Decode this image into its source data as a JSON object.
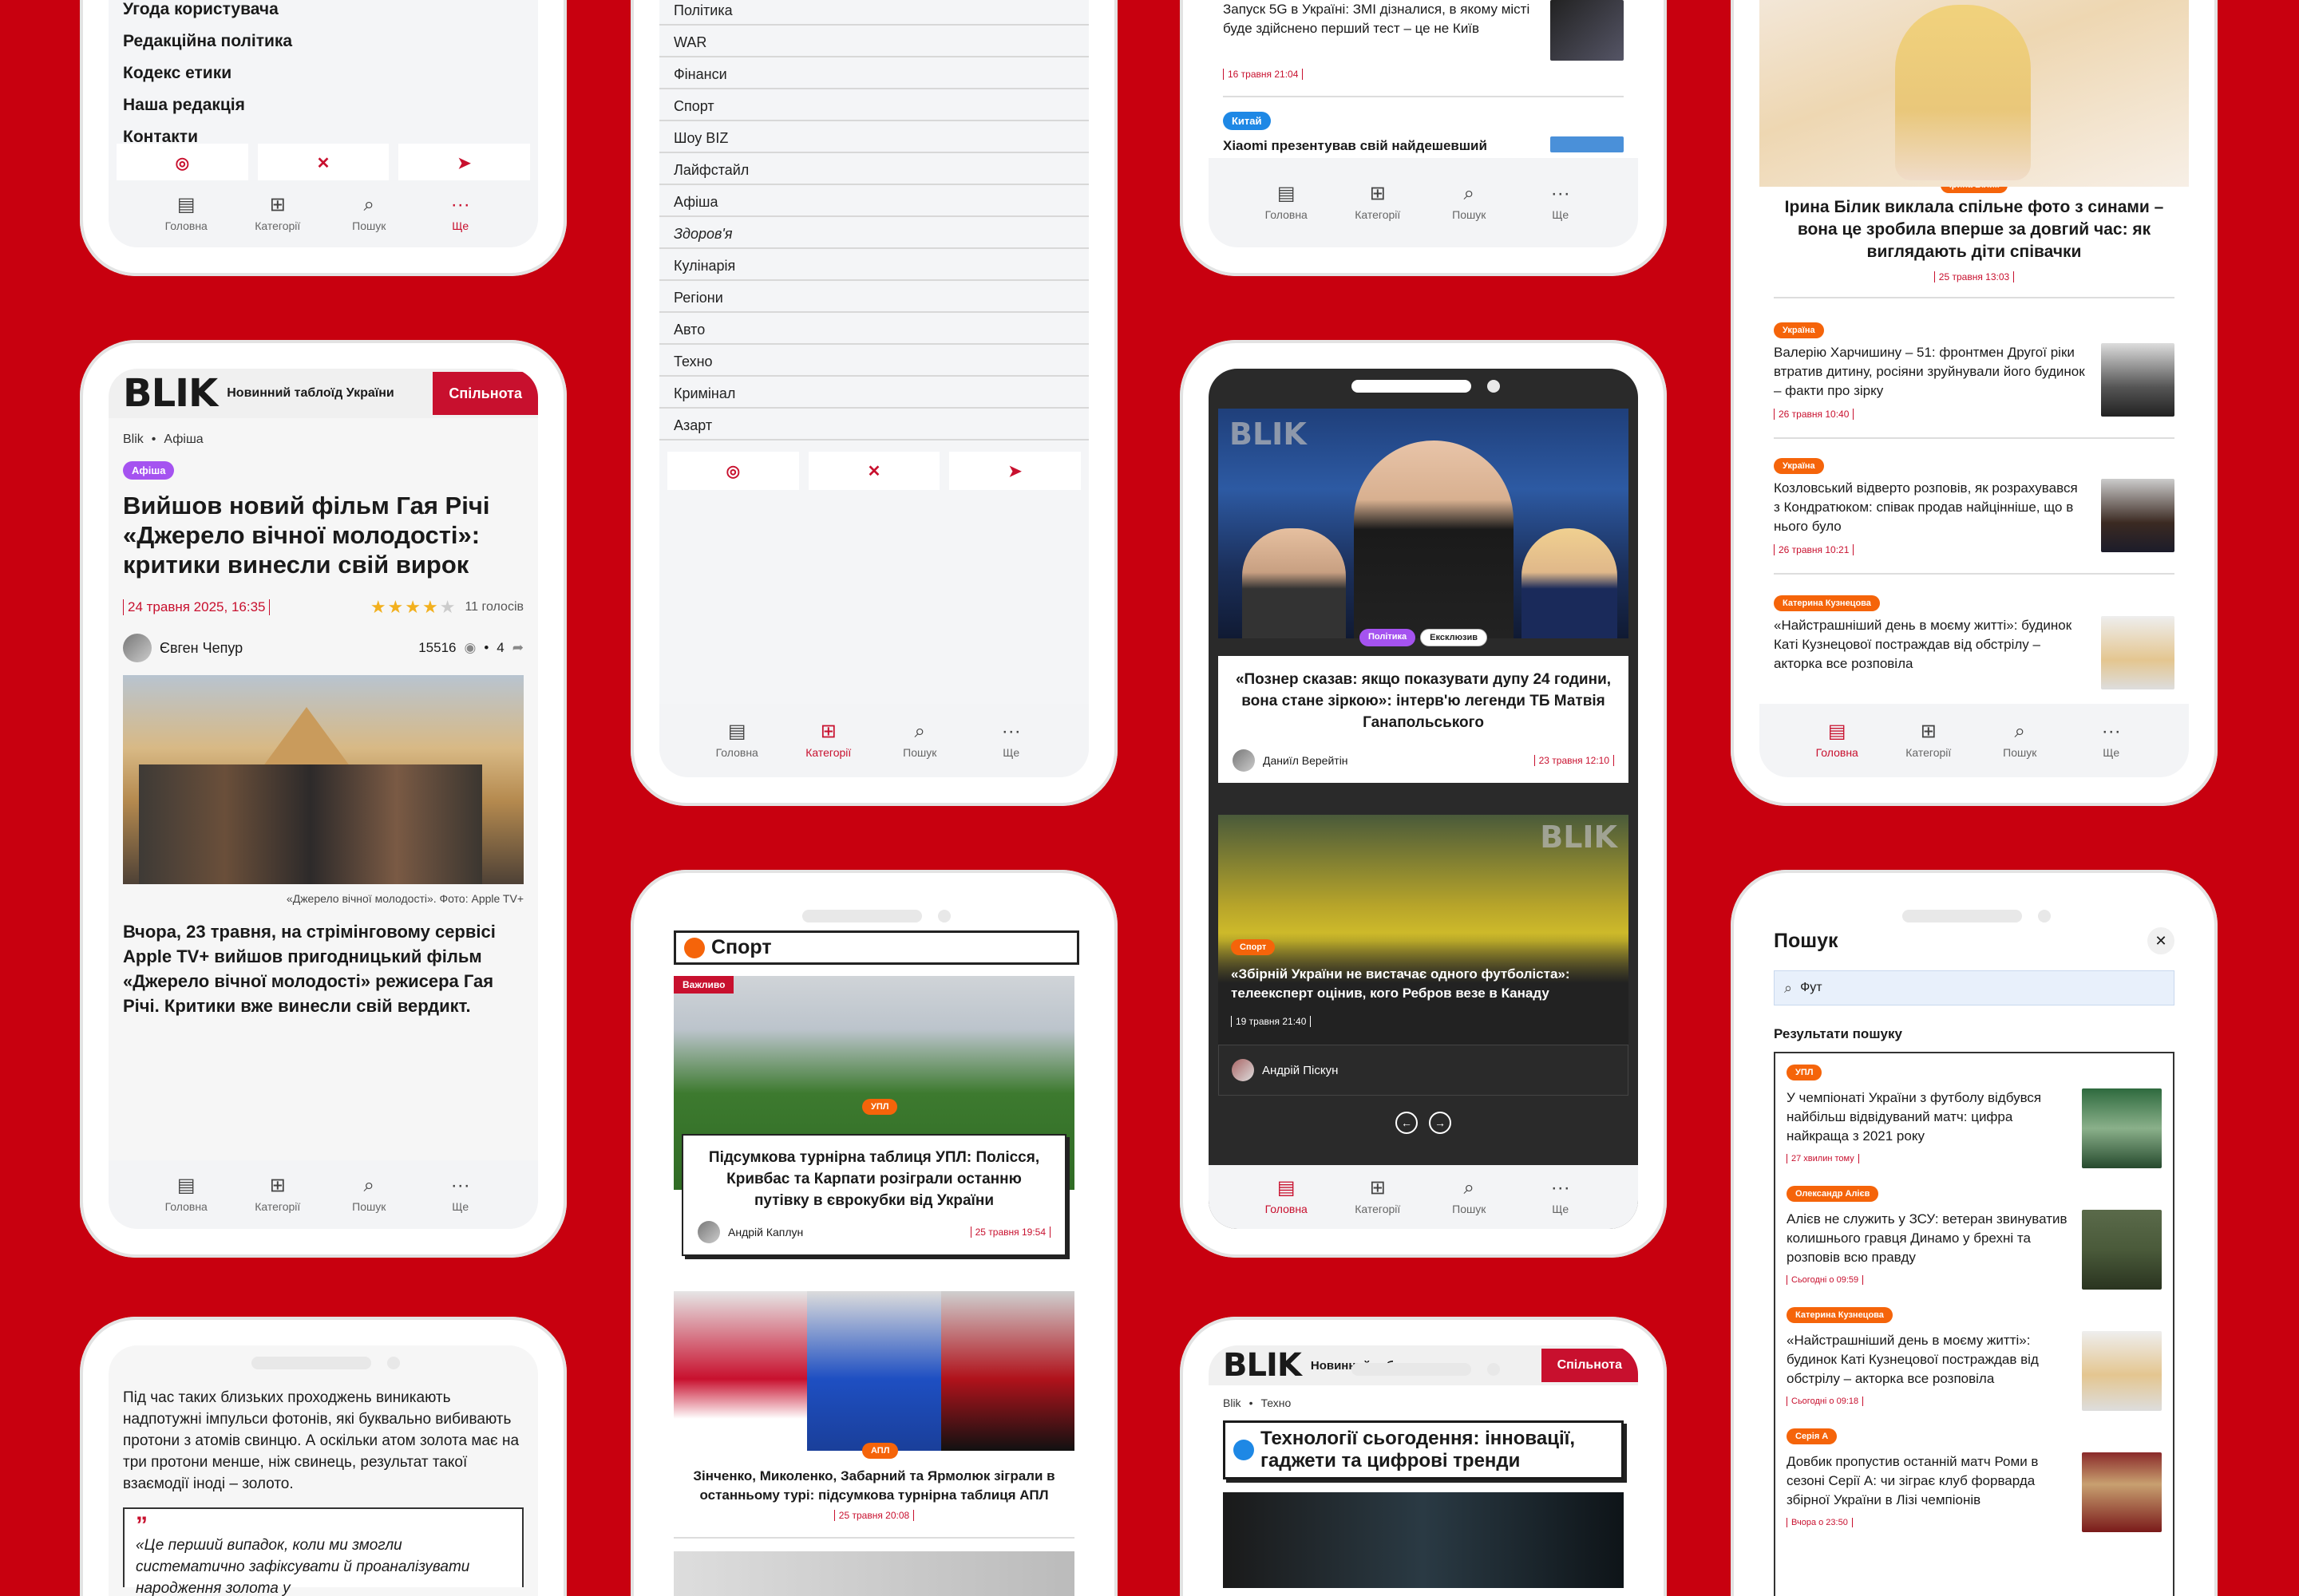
{
  "phone1": {
    "menu": [
      "Угода користувача",
      "Редакційна політика",
      "Кодекс етики",
      "Наша редакція",
      "Контакти"
    ],
    "tabs": [
      "Головна",
      "Категорії",
      "Пошук",
      "Ще"
    ]
  },
  "phone2": {
    "categories": [
      "Політика",
      "WAR",
      "Фінанси",
      "Спорт",
      "Шоу BIZ",
      "Лайфстайл",
      "Афіша",
      "Здоров'я",
      "Кулінарія",
      "Регіони",
      "Авто",
      "Техно",
      "Кримінал",
      "Азарт"
    ],
    "tabs": [
      "Головна",
      "Категорії",
      "Пошук",
      "Ще"
    ]
  },
  "phone3": {
    "news1_title": "Запуск 5G в Україні: ЗМІ дізналися, в якому місті буде здійснено перший тест – це не Київ",
    "news1_date": "16 травня 21:04",
    "badge": "Китай",
    "news2_title": "Xiaomi презентував свій найдешевший",
    "tabs": [
      "Головна",
      "Категорії",
      "Пошук",
      "Ще"
    ]
  },
  "phone4": {
    "hero_badge": "Ірина Білик",
    "hero_title": "Ірина Білик виклала спільне фото з синами – вона це зробила вперше за довгий час: як виглядають діти співачки",
    "hero_date": "25 травня 13:03",
    "items": [
      {
        "badge": "Україна",
        "title": "Валерію Харчишину – 51: фронтмен Другої ріки втратив дитину, росіяни зруйнували його будинок – факти про зірку",
        "date": "26 травня 10:40"
      },
      {
        "badge": "Україна",
        "title": "Козловський відверто розповів, як розрахувався з Кондратюком: співак продав найцінніше, що в нього було",
        "date": "26 травня 10:21"
      },
      {
        "badge": "Катерина Кузнецова",
        "title": "«Найстрашніший день в моєму житті»: будинок Каті Кузнецової постраждав від обстрілу – акторка все розповіла",
        "date": ""
      }
    ],
    "tabs": [
      "Головна",
      "Категорії",
      "Пошук",
      "Ще"
    ]
  },
  "phone5": {
    "logo": "BLIK",
    "ticker": "Новинний таблоїд України",
    "community_btn": "Спільнота",
    "crumb_home": "Blik",
    "crumb_section": "Афіша",
    "badge": "Афіша",
    "title": "Вийшов новий фільм Гая Річі «Джерело вічної молодості»: критики винесли свій вирок",
    "date": "24 травня 2025, 16:35",
    "votes": "11 голосів",
    "author": "Євген Чепур",
    "views": "15516",
    "comments": "4",
    "caption": "«Джерело вічної молодості». Фото: Apple TV+",
    "lead": "Вчора, 23 травня, на стрімінговому сервісі Apple TV+ вийшов пригодницький фільм «Джерело вічної молодості» режисера Гая Річі. Критики вже винесли свій вердикт.",
    "tabs": [
      "Головна",
      "Категорії",
      "Пошук",
      "Ще"
    ]
  },
  "phone6": {
    "section": "Спорт",
    "important": "Важливо",
    "badge1": "УПЛ",
    "card_title": "Підсумкова турнірна таблиця УПЛ: Полісся, Кривбас та Карпати розіграли останню путівку в єврокубки від України",
    "card_author": "Андрій Каплун",
    "card_date": "25 травня 19:54",
    "badge2": "АПЛ",
    "news2_title": "Зінченко, Миколенко, Забарний та Ярмолюк зіграли в останньому турі: підсумкова турнірна таблиця АПЛ",
    "news2_date": "25 травня 20:08"
  },
  "phone7": {
    "badges": [
      "Політика",
      "Ексклюзив"
    ],
    "card_title": "«Познер сказав: якщо показувати дупу 24 години, вона стане зіркою»: інтерв'ю легенди ТБ Матвія Ганапольського",
    "card_author": "Даниїл Верейтін",
    "card_date": "23 травня 12:10",
    "sport_badge": "Спорт",
    "sport_title": "«Збірній України не вистачає одного футболіста»: телеексперт оцінив, кого Ребров везе в Канаду",
    "sport_date": "19 травня 21:40",
    "sport_author": "Андрій Піскун",
    "tabs": [
      "Головна",
      "Категорії",
      "Пошук",
      "Ще"
    ]
  },
  "phone8": {
    "title": "Пошук",
    "query": "Фут",
    "results_label": "Результати пошуку",
    "results": [
      {
        "badge": "УПЛ",
        "title": "У чемпіонаті України з футболу відбувся найбільш відвідуваний матч: цифра найкраща з 2021 року",
        "date": "27 хвилин тому"
      },
      {
        "badge": "Олександр Алієв",
        "title": "Алієв не служить у ЗСУ: ветеран звинуватив колишнього гравця Динамо у брехні та розповів всю правду",
        "date": "Сьогодні о 09:59"
      },
      {
        "badge": "Катерина Кузнецова",
        "title": "«Найстрашніший день в моєму житті»: будинок Каті Кузнецової постраждав від обстрілу – акторка все розповіла",
        "date": "Сьогодні о 09:18"
      },
      {
        "badge": "Серія А",
        "title": "Довбик пропустив останній матч Роми в сезоні Серії А: чи зіграє клуб форварда збірної України в Лізі чемпіонів",
        "date": "Вчора о 23:50"
      }
    ]
  },
  "phone9": {
    "body": "Під час таких близьких проходжень виникають надпотужні імпульси фотонів, які буквально вибивають протони з атомів свинцю. А оскільки атом золота має на три протони менше, ніж свинець, результат такої взаємодії іноді – золото.",
    "quote_mark": "”",
    "quote": "«Це перший випадок, коли ми змогли систематично зафіксувати й проаналізувати народження золота у"
  },
  "phone10": {
    "logo": "BLIK",
    "ticker": "Новинний таб",
    "community_btn": "Спільнота",
    "crumb_home": "Blik",
    "crumb_section": "Техно",
    "heading": "Технології сьогодення: інновації, гаджети та цифрові тренди"
  },
  "colors": {
    "brand_red": "#c8102e",
    "background": "#c8000f",
    "badge_orange": "#f5640a",
    "badge_purple": "#a553f0",
    "badge_blue": "#1e88e5"
  }
}
